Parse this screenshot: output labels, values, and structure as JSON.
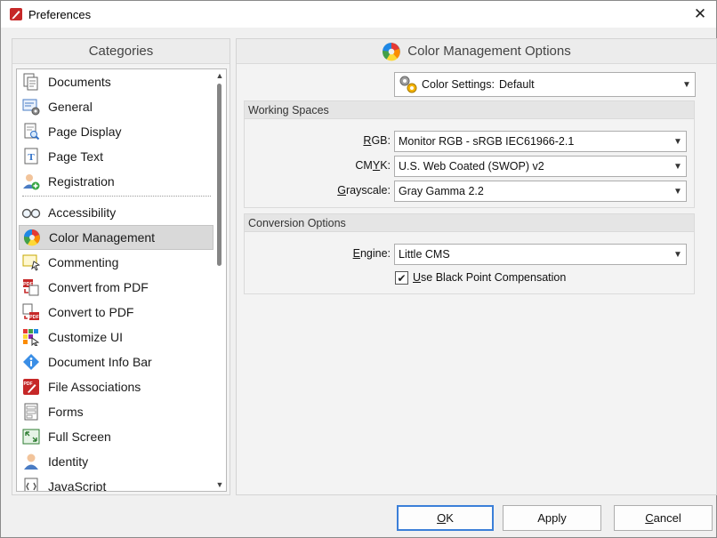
{
  "window": {
    "title": "Preferences",
    "close_glyph": "✕"
  },
  "categories": {
    "header": "Categories",
    "items": [
      {
        "label": "Documents",
        "icon": "documents-icon"
      },
      {
        "label": "General",
        "icon": "general-icon"
      },
      {
        "label": "Page Display",
        "icon": "page-display-icon"
      },
      {
        "label": "Page Text",
        "icon": "page-text-icon"
      },
      {
        "label": "Registration",
        "icon": "registration-icon"
      },
      {
        "label": "Accessibility",
        "icon": "accessibility-icon"
      },
      {
        "label": "Color Management",
        "icon": "color-management-icon",
        "selected": true
      },
      {
        "label": "Commenting",
        "icon": "commenting-icon"
      },
      {
        "label": "Convert from PDF",
        "icon": "convert-from-pdf-icon"
      },
      {
        "label": "Convert to PDF",
        "icon": "convert-to-pdf-icon"
      },
      {
        "label": "Customize UI",
        "icon": "customize-ui-icon"
      },
      {
        "label": "Document Info Bar",
        "icon": "document-info-bar-icon"
      },
      {
        "label": "File Associations",
        "icon": "file-associations-icon"
      },
      {
        "label": "Forms",
        "icon": "forms-icon"
      },
      {
        "label": "Full Screen",
        "icon": "full-screen-icon"
      },
      {
        "label": "Identity",
        "icon": "identity-icon"
      },
      {
        "label": "JavaScript",
        "icon": "javascript-icon"
      }
    ]
  },
  "options": {
    "header": "Color Management Options",
    "color_settings": {
      "label": "Color Settings:",
      "value": "Default"
    },
    "working_spaces": {
      "title": "Working Spaces",
      "rgb": {
        "label_access": "R",
        "label_rest": "GB:",
        "value": "Monitor RGB - sRGB IEC61966-2.1"
      },
      "cmyk": {
        "label_pre": "CM",
        "label_access": "Y",
        "label_rest": "K:",
        "value": "U.S. Web Coated (SWOP) v2"
      },
      "grayscale": {
        "label_access": "G",
        "label_rest": "rayscale:",
        "value": "Gray Gamma 2.2"
      }
    },
    "conversion": {
      "title": "Conversion Options",
      "engine": {
        "label_access": "E",
        "label_rest": "ngine:",
        "value": "Little CMS"
      },
      "black_point": {
        "label_access": "U",
        "label_rest": "se Black Point Compensation",
        "checked": true
      }
    }
  },
  "buttons": {
    "ok": {
      "access": "O",
      "rest": "K"
    },
    "apply": "Apply",
    "cancel": {
      "access": "C",
      "rest": "ancel"
    }
  },
  "colors": {
    "accent": "#3b7fd8",
    "selection": "#d9d9d9",
    "brand_red": "#c62828"
  }
}
